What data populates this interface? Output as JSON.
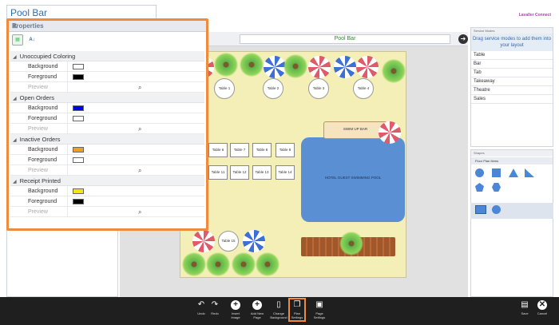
{
  "window": {
    "title": "Pool Bar",
    "brand": "Lavaller Connect"
  },
  "properties": {
    "title": "Properties",
    "sections": [
      {
        "name": "Unoccupied Coloring",
        "rows": [
          {
            "label": "Background",
            "color": "#ffffff"
          },
          {
            "label": "Foreground",
            "color": "#000000"
          },
          {
            "label": "Preview"
          }
        ]
      },
      {
        "name": "Open Orders",
        "rows": [
          {
            "label": "Background",
            "color": "#0000ee"
          },
          {
            "label": "Foreground",
            "color": "#ffffff"
          },
          {
            "label": "Preview"
          }
        ]
      },
      {
        "name": "Inactive Orders",
        "rows": [
          {
            "label": "Background",
            "color": "#f0a020"
          },
          {
            "label": "Foreground",
            "color": "#ffffff"
          },
          {
            "label": "Preview"
          }
        ]
      },
      {
        "name": "Receipt Printed",
        "rows": [
          {
            "label": "Background",
            "color": "#f5e800"
          },
          {
            "label": "Foreground",
            "color": "#000000"
          },
          {
            "label": "Preview"
          }
        ]
      }
    ]
  },
  "floor_plan": {
    "name": "Pool Bar",
    "swim_up_bar": "SWIM UP BAR",
    "pool_label": "HOTEL GUEST SWIMMING POOL",
    "round_tables": [
      "Table 1",
      "Table 2",
      "Table 3",
      "Table 4",
      "Table 15"
    ],
    "square_tables": [
      "Table 6",
      "Table 7",
      "Table 8",
      "Table 9",
      "Table 11",
      "Table 12",
      "Table 13",
      "Table 14"
    ]
  },
  "service_modes": {
    "header": "Service Modes",
    "hint": "Drag service modes to add them into your layout",
    "items": [
      "Table",
      "Bar",
      "Tab",
      "Takeaway",
      "Theatre",
      "Sales"
    ]
  },
  "shapes": {
    "header": "Shapes",
    "category": "Floor Plan Items"
  },
  "toolbar": {
    "undo": "Undo",
    "redo": "Redo",
    "insert_image": "Insert Image",
    "add_new_page": "Add New Page",
    "change_background": "Change Background",
    "plan_settings": "Plan Settings",
    "page_settings": "Page Settings",
    "save": "Save",
    "cancel": "Cancel"
  }
}
